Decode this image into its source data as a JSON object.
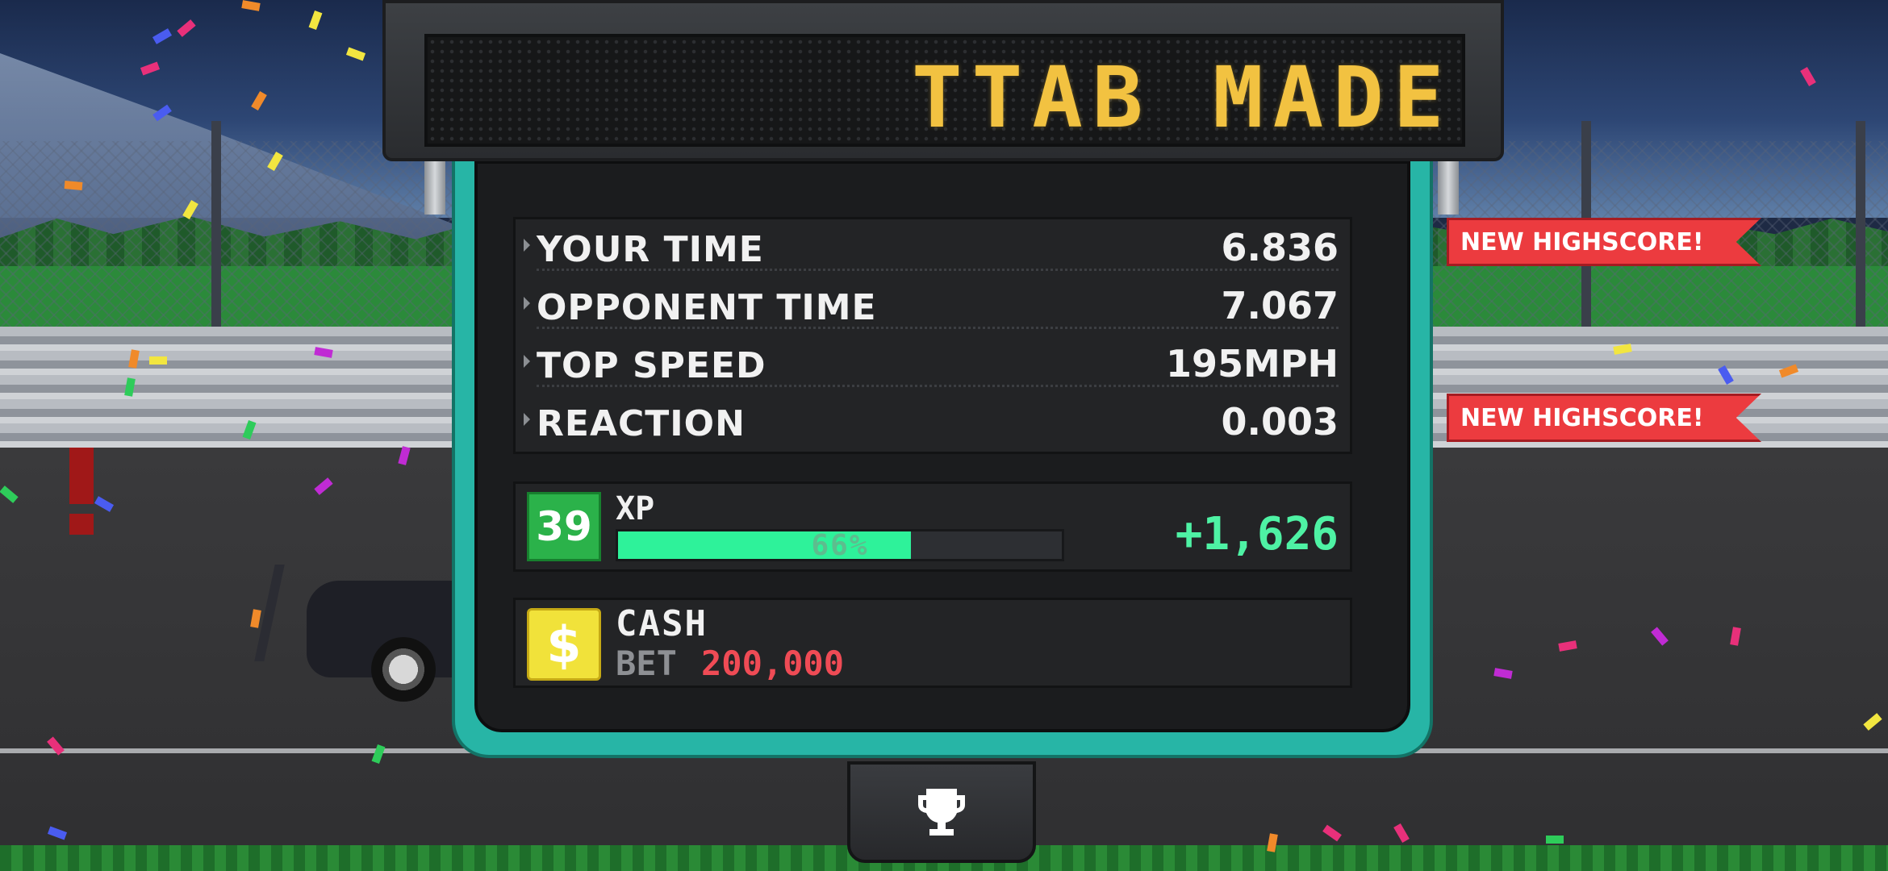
{
  "marquee": {
    "text": "TTAB MADE I"
  },
  "stats": [
    {
      "label": "YOUR TIME",
      "value": "6.836"
    },
    {
      "label": "OPPONENT TIME",
      "value": "7.067"
    },
    {
      "label": "TOP SPEED",
      "value": "195MPH"
    },
    {
      "label": "REACTION",
      "value": "0.003"
    }
  ],
  "xp": {
    "level": "39",
    "label": "XP",
    "progress_percent": 66,
    "progress_text": "66%",
    "gain": "+1,626"
  },
  "cash": {
    "icon": "dollar-icon",
    "label": "CASH",
    "bet_label": "BET",
    "bet_value": "200,000"
  },
  "highscores": [
    {
      "label": "NEW HIGHSCORE!"
    },
    {
      "label": "NEW HIGHSCORE!"
    }
  ],
  "trophy": {
    "icon": "trophy-icon"
  },
  "colors": {
    "accent_teal": "#27b5a6",
    "marquee_amber": "#f2c241",
    "xp_green": "#2ef29a",
    "bet_red": "#ef4b55",
    "ribbon_red": "#ec3b3f"
  }
}
